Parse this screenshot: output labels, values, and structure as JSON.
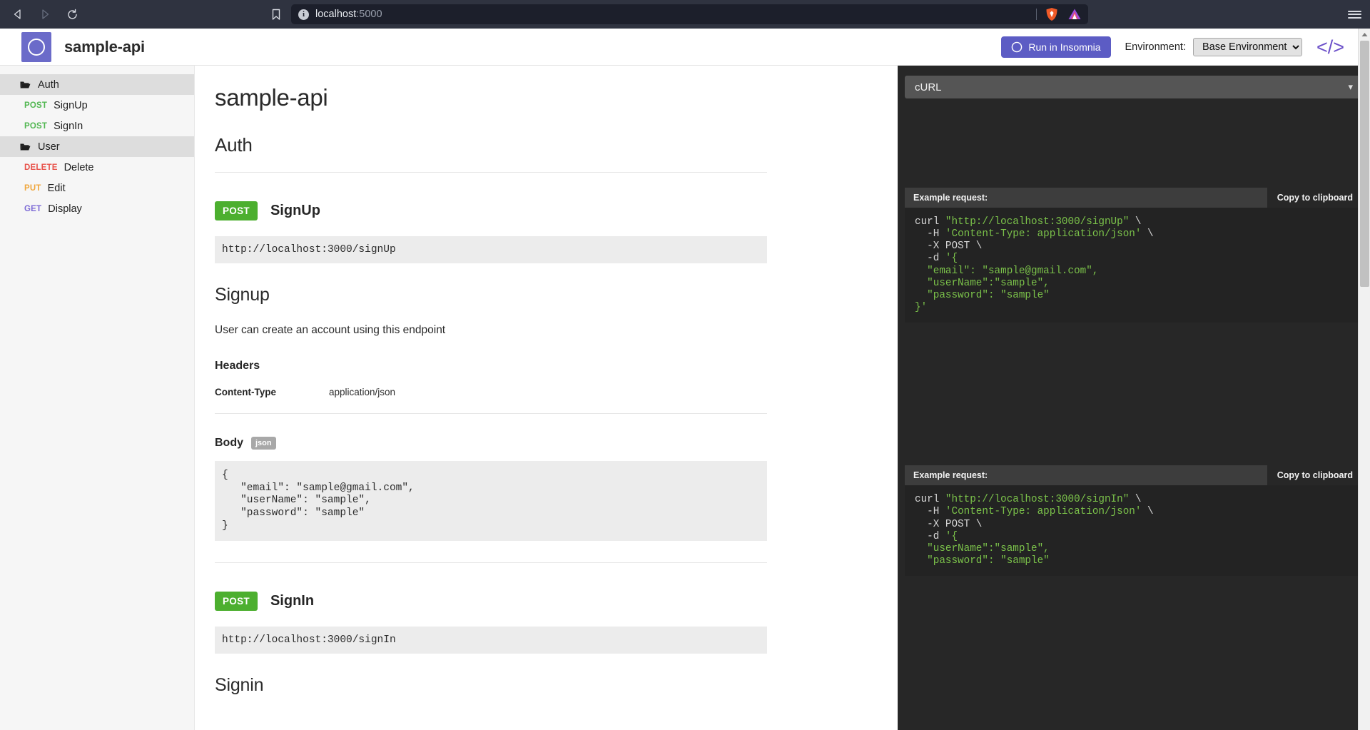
{
  "browser": {
    "back_icon": "back-arrow-icon",
    "forward_icon": "forward-arrow-icon",
    "reload_icon": "reload-icon",
    "bookmark_icon": "bookmark-icon",
    "info_icon": "info-icon",
    "info_glyph": "i",
    "url_host": "localhost",
    "url_port": ":5000",
    "shield_icon": "brave-shield-icon",
    "brave_icon": "brave-logo-icon",
    "menu_icon": "hamburger-menu-icon"
  },
  "header": {
    "logo_icon": "insomnia-moon-logo",
    "title": "sample-api",
    "run_button": "Run in Insomnia",
    "run_button_icon": "insomnia-moon-icon",
    "environment_label": "Environment:",
    "environment_value": "Base Environment",
    "environment_options": [
      "Base Environment"
    ],
    "code_icon": "</>",
    "accent_color": "#5c5cc4"
  },
  "sidebar": {
    "groups": [
      {
        "name": "Auth",
        "folder_icon": "folder-open-icon",
        "items": [
          {
            "method": "POST",
            "method_class": "m-post",
            "name": "SignUp"
          },
          {
            "method": "POST",
            "method_class": "m-post",
            "name": "SignIn"
          }
        ]
      },
      {
        "name": "User",
        "folder_icon": "folder-open-icon",
        "items": [
          {
            "method": "DELETE",
            "method_class": "m-delete",
            "name": "Delete"
          },
          {
            "method": "PUT",
            "method_class": "m-put",
            "name": "Edit"
          },
          {
            "method": "GET",
            "method_class": "m-get",
            "name": "Display"
          }
        ]
      }
    ],
    "method_colors": {
      "POST": "#51b751",
      "DELETE": "#e8524a",
      "PUT": "#f0a73d",
      "GET": "#7d6bd6"
    }
  },
  "main": {
    "doc_title": "sample-api",
    "group_title": "Auth",
    "endpoints": [
      {
        "method": "POST",
        "name": "SignUp",
        "url": "http://localhost:3000/signUp",
        "heading": "Signup",
        "description": "User can create an account using this endpoint",
        "headers_title": "Headers",
        "headers": [
          {
            "key": "Content-Type",
            "value": "application/json"
          }
        ],
        "body_title": "Body",
        "body_format": "json",
        "body_code": "{\n   \"email\": \"sample@gmail.com\",\n   \"userName\": \"sample\",\n   \"password\": \"sample\"\n}"
      },
      {
        "method": "POST",
        "name": "SignIn",
        "url": "http://localhost:3000/signIn",
        "heading": "Signin"
      }
    ]
  },
  "right_panel": {
    "language": "cURL",
    "language_options": [
      "cURL"
    ],
    "chevron_icon": "chevron-down-icon",
    "examples": [
      {
        "label": "Example request:",
        "copy_label": "Copy to clipboard",
        "lines": [
          {
            "parts": [
              {
                "t": "curl ",
                "c": "p"
              },
              {
                "t": "\"http://localhost:3000/signUp\"",
                "c": "s"
              },
              {
                "t": " \\",
                "c": "p"
              }
            ]
          },
          {
            "parts": [
              {
                "t": "  -H ",
                "c": "p"
              },
              {
                "t": "'Content-Type: application/json'",
                "c": "s"
              },
              {
                "t": " \\",
                "c": "p"
              }
            ]
          },
          {
            "parts": [
              {
                "t": "  -X POST \\",
                "c": "p"
              }
            ]
          },
          {
            "parts": [
              {
                "t": "  -d ",
                "c": "p"
              },
              {
                "t": "'{",
                "c": "s"
              }
            ]
          },
          {
            "parts": [
              {
                "t": "  \"email\": \"sample@gmail.com\",",
                "c": "s"
              }
            ]
          },
          {
            "parts": [
              {
                "t": "  \"userName\":\"sample\",",
                "c": "s"
              }
            ]
          },
          {
            "parts": [
              {
                "t": "  \"password\": \"sample\"",
                "c": "s"
              }
            ]
          },
          {
            "parts": [
              {
                "t": "}'",
                "c": "s"
              }
            ]
          }
        ]
      },
      {
        "label": "Example request:",
        "copy_label": "Copy to clipboard",
        "lines": [
          {
            "parts": [
              {
                "t": "curl ",
                "c": "p"
              },
              {
                "t": "\"http://localhost:3000/signIn\"",
                "c": "s"
              },
              {
                "t": " \\",
                "c": "p"
              }
            ]
          },
          {
            "parts": [
              {
                "t": "  -H ",
                "c": "p"
              },
              {
                "t": "'Content-Type: application/json'",
                "c": "s"
              },
              {
                "t": " \\",
                "c": "p"
              }
            ]
          },
          {
            "parts": [
              {
                "t": "  -X POST \\",
                "c": "p"
              }
            ]
          },
          {
            "parts": [
              {
                "t": "  -d ",
                "c": "p"
              },
              {
                "t": "'{",
                "c": "s"
              }
            ]
          },
          {
            "parts": [
              {
                "t": "  \"userName\":\"sample\",",
                "c": "s"
              }
            ]
          },
          {
            "parts": [
              {
                "t": "  \"password\": \"sample\"",
                "c": "s"
              }
            ]
          }
        ]
      }
    ]
  }
}
